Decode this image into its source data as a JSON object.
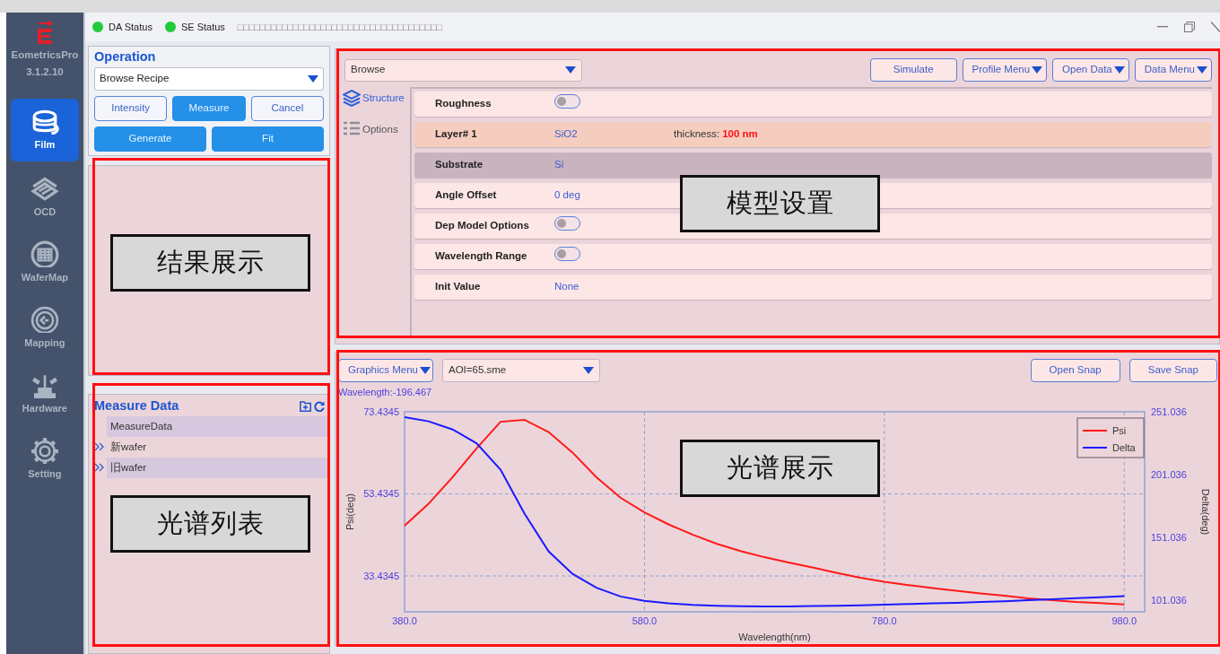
{
  "sidebar": {
    "app_name": "EometricsPro",
    "version": "3.1.2.10",
    "items": [
      {
        "label": "Film",
        "kind": "film",
        "selected": true
      },
      {
        "label": "OCD",
        "kind": "ocd",
        "selected": false
      },
      {
        "label": "WaferMap",
        "kind": "wafermap",
        "selected": false
      },
      {
        "label": "Mapping",
        "kind": "mapping",
        "selected": false
      },
      {
        "label": "Hardware",
        "kind": "hardware",
        "selected": false
      },
      {
        "label": "Setting",
        "kind": "setting",
        "selected": false
      }
    ]
  },
  "title_bar": {
    "statuses": [
      {
        "label": "DA Status",
        "color": "#22c93c"
      },
      {
        "label": "SE Status",
        "color": "#22c93c"
      }
    ],
    "title": "□□□□□□□□□□□□□□□□□□□□□□□□□□□□□□□□□□□□□"
  },
  "operation": {
    "title": "Operation",
    "recipe_select": {
      "value": "Browse Recipe"
    },
    "buttons": [
      {
        "label": "Intensity",
        "kind": "outline"
      },
      {
        "label": "Measure",
        "kind": "filled"
      },
      {
        "label": "Cancel",
        "kind": "outline"
      },
      {
        "label": "Generate",
        "kind": "filled"
      },
      {
        "label": "Fit",
        "kind": "filled"
      }
    ]
  },
  "results": {
    "annotation": "结果展示"
  },
  "measure_data": {
    "title": "Measure Data",
    "items": [
      {
        "label": "MeasureData",
        "expandable": false
      },
      {
        "label": "新wafer",
        "expandable": true
      },
      {
        "label": "旧wafer",
        "expandable": true
      }
    ],
    "annotation": "光谱列表"
  },
  "model": {
    "select": {
      "value": "Browse"
    },
    "buttons": [
      {
        "label": "Simulate",
        "dropdown": false
      },
      {
        "label": "Profile Menu",
        "dropdown": true
      },
      {
        "label": "Open Data",
        "dropdown": true
      },
      {
        "label": "Data Menu",
        "dropdown": true
      }
    ],
    "tabs": [
      {
        "label": "Structure",
        "kind": "layers",
        "selected": true
      },
      {
        "label": "Options",
        "kind": "list",
        "selected": false
      }
    ],
    "rows": [
      {
        "kind": "toggle",
        "label": "Roughness",
        "on": false
      },
      {
        "kind": "layer",
        "label": "Layer# 1",
        "value": "SiO2",
        "detail_label": "thickness:",
        "detail_value": "100 nm"
      },
      {
        "kind": "substrate",
        "label": "Substrate",
        "value": "Si"
      },
      {
        "kind": "value",
        "label": "Angle Offset",
        "value": "0 deg"
      },
      {
        "kind": "toggle",
        "label": "Dep Model Options",
        "on": false
      },
      {
        "kind": "toggle",
        "label": "Wavelength Range",
        "on": false
      },
      {
        "kind": "value",
        "label": "Init Value",
        "value": "None"
      }
    ],
    "annotation": "模型设置"
  },
  "spectrum": {
    "menu_button": {
      "label": "Graphics Menu"
    },
    "file_select": {
      "value": "AOI=65.sme"
    },
    "buttons": [
      {
        "label": "Open Snap"
      },
      {
        "label": "Save Snap"
      }
    ],
    "cursor_readout": "Wavelength:-196.467",
    "annotation": "光谱展示",
    "chart_data": {
      "type": "line",
      "xlabel": "Wavelength(nm)",
      "ylabel": "Psi(deg)",
      "y2label": "Delta(deg)",
      "x": [
        380,
        400,
        420,
        440,
        460,
        480,
        500,
        520,
        540,
        560,
        580,
        600,
        620,
        640,
        660,
        680,
        700,
        720,
        740,
        760,
        780,
        800,
        820,
        840,
        860,
        880,
        900,
        920,
        940,
        960,
        980
      ],
      "series": [
        {
          "name": "Psi",
          "color": "#ff1a1a",
          "values": [
            45.7,
            51,
            57.5,
            64.5,
            71,
            71.5,
            68.5,
            63.5,
            57.5,
            52.5,
            48.9,
            46,
            43.5,
            41.3,
            39.5,
            38,
            36.7,
            35.5,
            34.2,
            33,
            32,
            31.2,
            30.5,
            29.8,
            29.2,
            28.6,
            28,
            27.5,
            27.1,
            26.8,
            26.5
          ]
        },
        {
          "name": "Delta",
          "color": "#1a1aff",
          "axis": "y2",
          "values": [
            246.7,
            243.5,
            237,
            226,
            205,
            170,
            140,
            122,
            111,
            104,
            100.5,
            98.5,
            97.3,
            96.6,
            96.2,
            96,
            96.1,
            96.3,
            96.6,
            97,
            97.5,
            98,
            98.5,
            99,
            99.6,
            100.2,
            101,
            101.8,
            102.6,
            103.4,
            104.2
          ]
        }
      ],
      "grid": true,
      "legend": true,
      "xlim": [
        380,
        997
      ],
      "ylim": [
        24.69,
        73.4345
      ],
      "y2lim": [
        91.75,
        251.036
      ],
      "xticks": [
        {
          "value": 380,
          "label": "380.0"
        },
        {
          "value": 580,
          "label": "580.0"
        },
        {
          "value": 780,
          "label": "780.0"
        },
        {
          "value": 980,
          "label": "980.0"
        }
      ],
      "yticks": [
        {
          "value": 33.4345,
          "label": "33.4345"
        },
        {
          "value": 53.4345,
          "label": "53.4345"
        },
        {
          "value": 73.4345,
          "label": "73.4345"
        }
      ],
      "y2ticks": [
        {
          "value": 101.036,
          "label": "101.036"
        },
        {
          "value": 151.036,
          "label": "151.036"
        },
        {
          "value": 201.036,
          "label": "201.036"
        },
        {
          "value": 251.036,
          "label": "251.036"
        }
      ]
    }
  }
}
